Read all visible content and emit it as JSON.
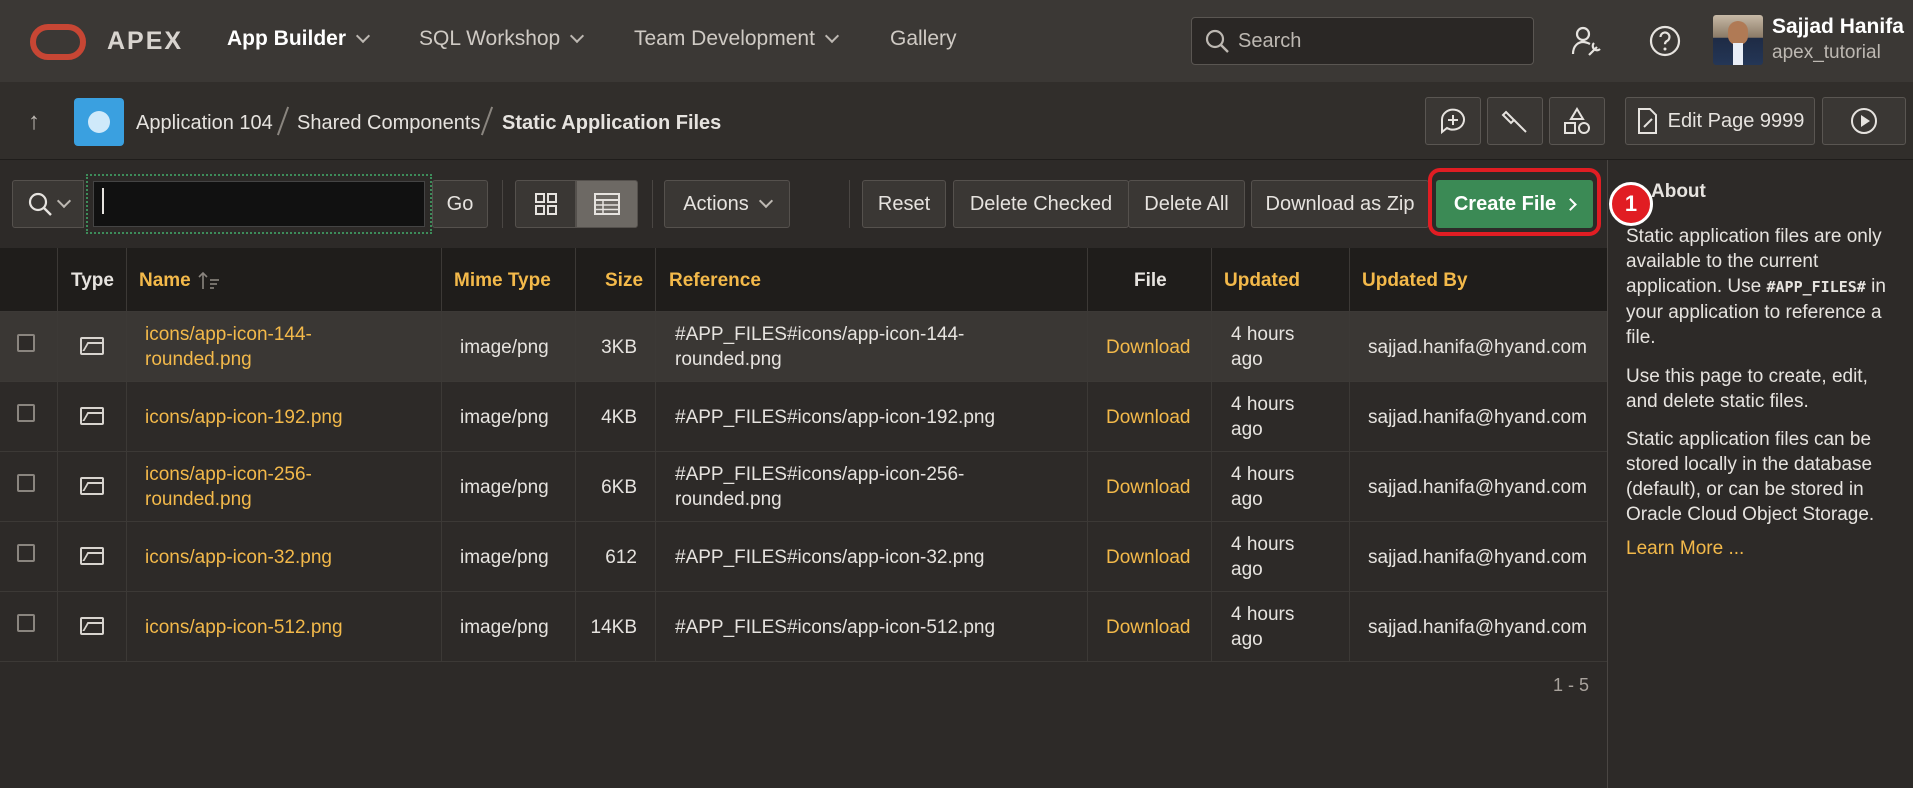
{
  "header": {
    "brand": "APEX",
    "nav": [
      {
        "label": "App Builder"
      },
      {
        "label": "SQL Workshop"
      },
      {
        "label": "Team Development"
      },
      {
        "label": "Gallery"
      }
    ],
    "search_placeholder": "Search",
    "user": {
      "name": "Sajjad Hanifa",
      "workspace": "apex_tutorial"
    }
  },
  "breadcrumb": {
    "items": [
      "Application 104",
      "Shared Components",
      "Static Application Files"
    ],
    "edit_page_label": "Edit Page 9999"
  },
  "toolbar": {
    "go_label": "Go",
    "actions_label": "Actions",
    "reset_label": "Reset",
    "delete_checked_label": "Delete Checked",
    "delete_all_label": "Delete All",
    "download_zip_label": "Download as Zip",
    "create_file_label": "Create File",
    "step_marker": "1"
  },
  "table": {
    "columns": [
      "Type",
      "Name",
      "Mime Type",
      "Size",
      "Reference",
      "File",
      "Updated",
      "Updated By"
    ],
    "rows": [
      {
        "name_1": "icons/app-icon-144-",
        "name_2": "rounded.png",
        "mime": "image/png",
        "size": "3KB",
        "ref_1": "#APP_FILES#icons/app-icon-144-",
        "ref_2": "rounded.png",
        "file": "Download",
        "upd_1": "4 hours",
        "upd_2": "ago",
        "by": "sajjad.hanifa@hyand.com"
      },
      {
        "name_1": "icons/app-icon-192.png",
        "name_2": "",
        "mime": "image/png",
        "size": "4KB",
        "ref_1": "#APP_FILES#icons/app-icon-192.png",
        "ref_2": "",
        "file": "Download",
        "upd_1": "4 hours",
        "upd_2": "ago",
        "by": "sajjad.hanifa@hyand.com"
      },
      {
        "name_1": "icons/app-icon-256-",
        "name_2": "rounded.png",
        "mime": "image/png",
        "size": "6KB",
        "ref_1": "#APP_FILES#icons/app-icon-256-",
        "ref_2": "rounded.png",
        "file": "Download",
        "upd_1": "4 hours",
        "upd_2": "ago",
        "by": "sajjad.hanifa@hyand.com"
      },
      {
        "name_1": "icons/app-icon-32.png",
        "name_2": "",
        "mime": "image/png",
        "size": "612",
        "ref_1": "#APP_FILES#icons/app-icon-32.png",
        "ref_2": "",
        "file": "Download",
        "upd_1": "4 hours",
        "upd_2": "ago",
        "by": "sajjad.hanifa@hyand.com"
      },
      {
        "name_1": "icons/app-icon-512.png",
        "name_2": "",
        "mime": "image/png",
        "size": "14KB",
        "ref_1": "#APP_FILES#icons/app-icon-512.png",
        "ref_2": "",
        "file": "Download",
        "upd_1": "4 hours",
        "upd_2": "ago",
        "by": "sajjad.hanifa@hyand.com"
      }
    ],
    "pagination": "1 - 5"
  },
  "about": {
    "heading": "About",
    "p1_before": "Static application files are only available to the current application. Use",
    "p1_code": "#APP_FILES#",
    "p1_after": "in your application to reference a file.",
    "p2": "Use this page to create, edit, and delete static files.",
    "p3": "Static application files can be stored locally in the database (default), or can be stored in Oracle Cloud Object Storage.",
    "learn_more": "Learn More ..."
  },
  "colors": {
    "accent_link": "#f3b94a",
    "create_button": "#3b8a55",
    "highlight": "#e11d23",
    "oracle_red": "#c74634"
  }
}
